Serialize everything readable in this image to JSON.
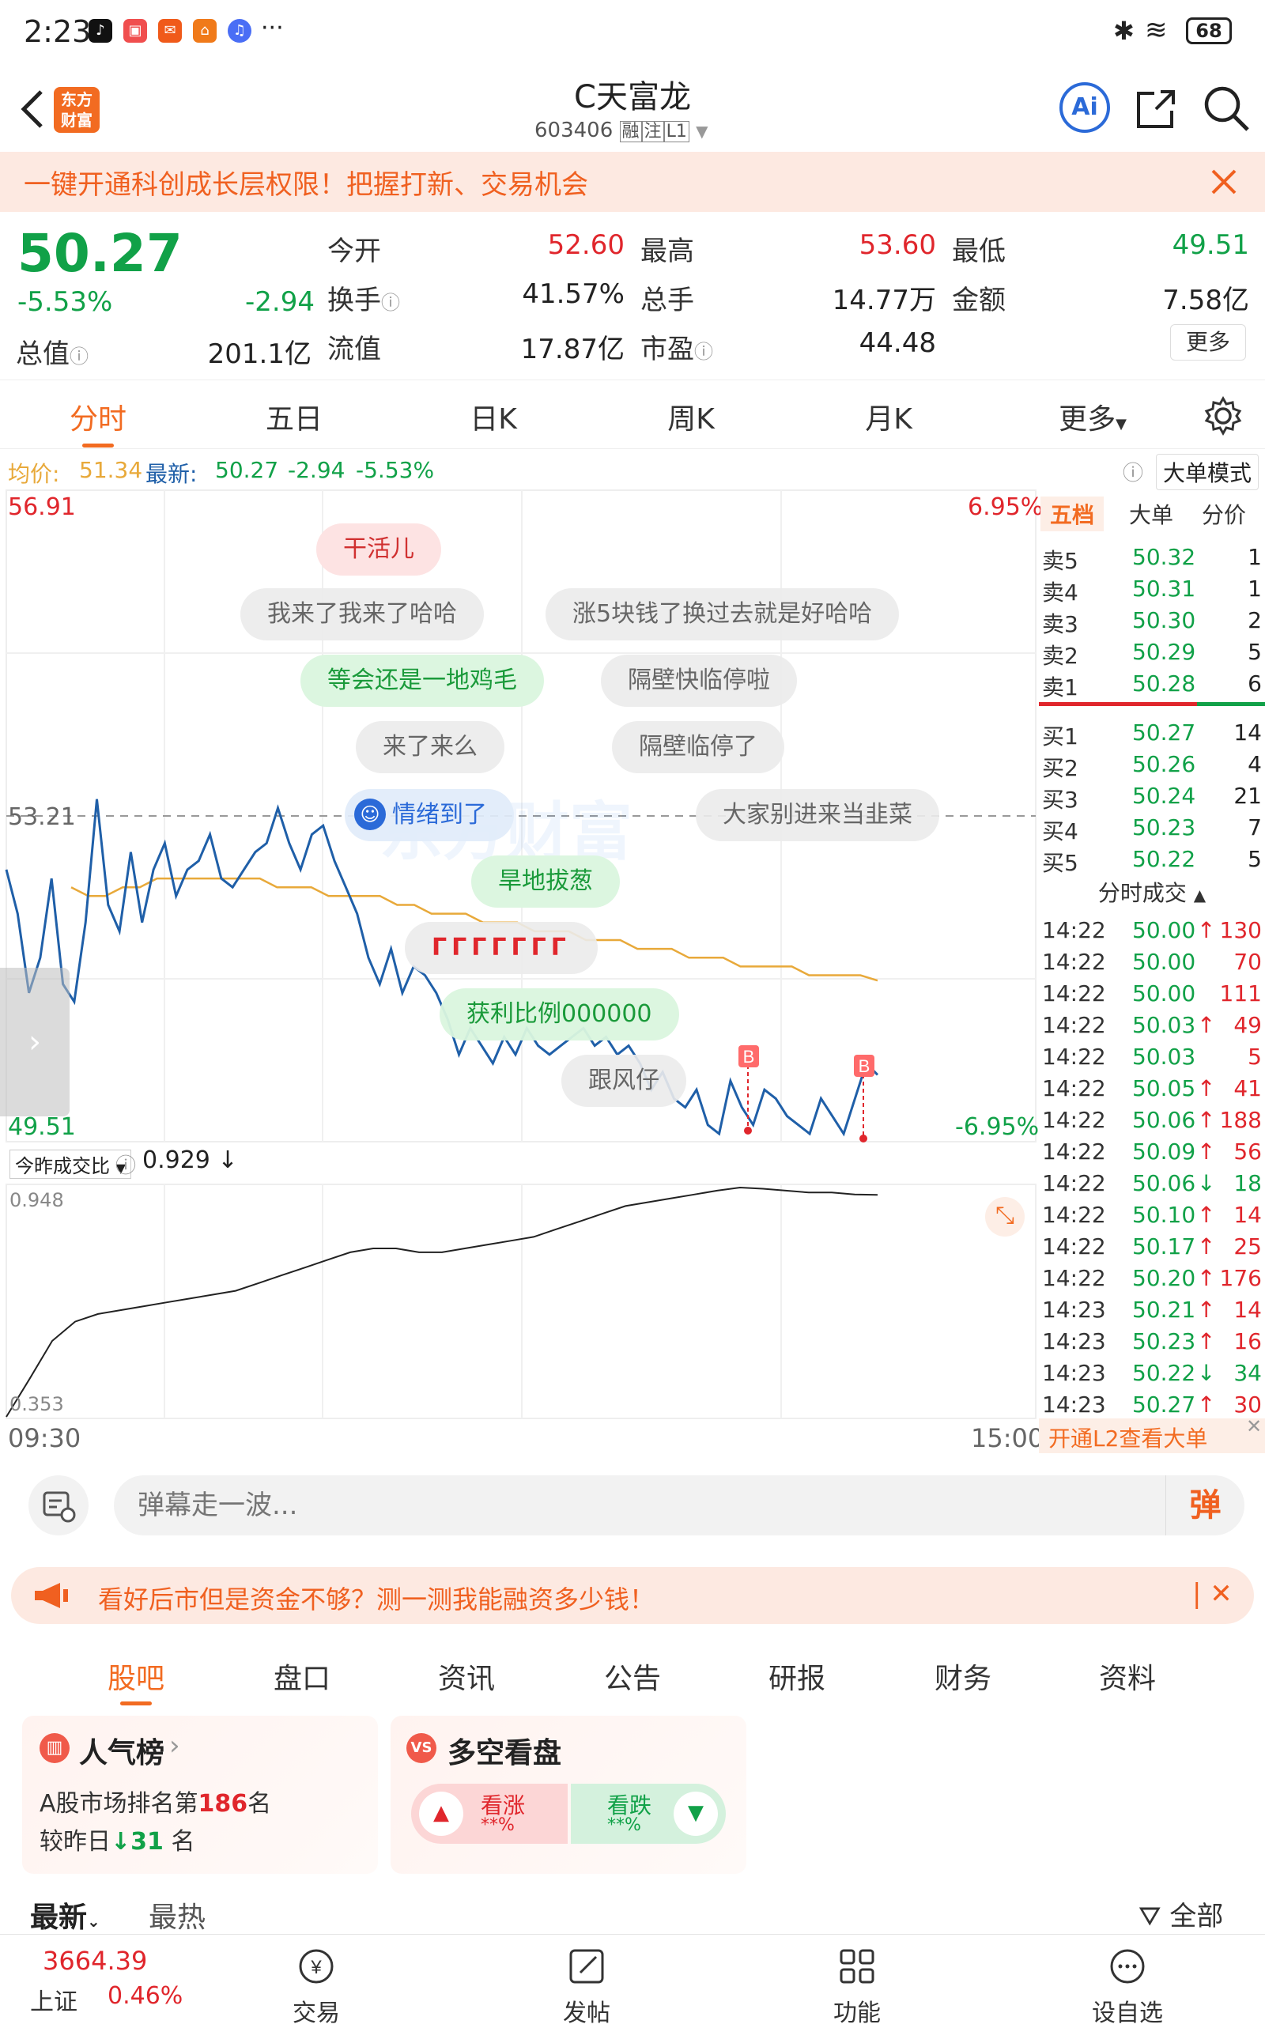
{
  "status_bar": {
    "time": "2:23",
    "more": "···",
    "battery": "68"
  },
  "header": {
    "back_icon": "chevron-left-icon",
    "logo_text": "东方\n财富",
    "title": "C天富龙",
    "code": "603406",
    "tags": [
      "融",
      "注",
      "L1"
    ],
    "ai_label": "Ai"
  },
  "banner": {
    "text": "一键开通科创成长层权限！把握打新、交易机会"
  },
  "quote": {
    "price": "50.27",
    "change_pct": "-5.53%",
    "change": "-2.94",
    "rows": [
      [
        {
          "label": "今开",
          "value": "52.60",
          "color": "red"
        },
        {
          "label": "最高",
          "value": "53.60",
          "color": "red"
        },
        {
          "label": "最低",
          "value": "49.51",
          "color": "green"
        }
      ],
      [
        {
          "label": "换手",
          "value": "41.57%",
          "color": "dark"
        },
        {
          "label": "总手",
          "value": "14.77万",
          "color": "dark"
        },
        {
          "label": "金额",
          "value": "7.58亿",
          "color": "dark"
        }
      ],
      [
        {
          "label": "流值",
          "value": "17.87亿",
          "color": "dark"
        },
        {
          "label": "市盈",
          "value": "44.48",
          "color": "dark"
        }
      ]
    ],
    "total_label": "总值",
    "total_value": "201.1亿",
    "more_button": "更多"
  },
  "tabs": [
    "分时",
    "五日",
    "日K",
    "周K",
    "月K",
    "更多"
  ],
  "chart_info": {
    "avg_label": "均价:",
    "avg_value": "51.34",
    "latest_label": "最新:",
    "latest_value": "50.27",
    "latest_change": "-2.94",
    "latest_pct": "-5.53%",
    "mode_button": "大单模式"
  },
  "chart_labels": {
    "y_high": "56.91",
    "y_low": "49.51",
    "y_mid": "53.21",
    "pct_high": "6.95%",
    "pct_low": "-6.95%",
    "indicator": "今昨成交比",
    "indicator_value": "0.929",
    "ind_high": "0.948",
    "ind_low": "0.353",
    "t_start": "09:30",
    "t_end": "15:00",
    "marker": "B"
  },
  "danmaku": [
    "干活儿",
    "我来了我来了哈哈",
    "涨5块钱了换过去就是好哈哈",
    "等会还是一地鸡毛",
    "隔壁快临停啦",
    "来了来么",
    "隔壁临停了",
    "情绪到了",
    "大家别进来当韭菜",
    "旱地拔葱",
    "ΓΓΓΓΓΓΓ",
    "获利比例000000",
    "跟风仔"
  ],
  "watermark": "东方财富",
  "chart_data": [
    {
      "type": "line",
      "title": "",
      "x_range": [
        "09:30",
        "15:00"
      ],
      "ylim": [
        49.51,
        56.91
      ],
      "reference": 53.21,
      "series": [
        {
          "name": "最新",
          "values": [
            52.6,
            52.1,
            51.2,
            51.6,
            52.5,
            51.3,
            51.1,
            52.0,
            53.4,
            52.2,
            51.9,
            52.8,
            52.0,
            52.6,
            52.9,
            52.3,
            52.6,
            52.7,
            53.0,
            52.5,
            52.4,
            52.6,
            52.8,
            52.9,
            53.3,
            52.9,
            52.6,
            53.0,
            53.1,
            52.7,
            52.4,
            52.1,
            51.6,
            51.3,
            51.7,
            51.2,
            51.5,
            51.4,
            51.2,
            50.9,
            50.5,
            50.8,
            50.6,
            50.4,
            50.7,
            50.5,
            50.8,
            50.6,
            50.5,
            50.6,
            50.7,
            50.8,
            50.6,
            50.7,
            50.5,
            50.6,
            50.4,
            50.1,
            50.3,
            50.0,
            49.9,
            50.1,
            49.7,
            49.6,
            50.2,
            49.9,
            49.7,
            50.1,
            50.0,
            49.8,
            49.7,
            49.6,
            50.0,
            49.8,
            49.6,
            50.0,
            50.4,
            50.27
          ]
        },
        {
          "name": "均价",
          "values": [
            52.4,
            52.3,
            52.3,
            52.4,
            52.4,
            52.5,
            52.5,
            52.5,
            52.5,
            52.5,
            52.5,
            52.5,
            52.4,
            52.4,
            52.4,
            52.3,
            52.3,
            52.3,
            52.3,
            52.2,
            52.2,
            52.1,
            52.1,
            52.1,
            52.0,
            52.0,
            52.0,
            51.9,
            51.9,
            51.9,
            51.8,
            51.8,
            51.8,
            51.7,
            51.7,
            51.7,
            51.6,
            51.6,
            51.6,
            51.5,
            51.5,
            51.5,
            51.5,
            51.4,
            51.4,
            51.4,
            51.4,
            51.34
          ]
        }
      ]
    },
    {
      "type": "line",
      "title": "",
      "ylim": [
        0.353,
        0.948
      ],
      "series": [
        {
          "name": "今昨成交比",
          "values": [
            0.353,
            0.45,
            0.55,
            0.6,
            0.62,
            0.63,
            0.64,
            0.65,
            0.66,
            0.67,
            0.68,
            0.7,
            0.72,
            0.74,
            0.76,
            0.78,
            0.79,
            0.79,
            0.78,
            0.78,
            0.79,
            0.8,
            0.81,
            0.82,
            0.84,
            0.86,
            0.88,
            0.9,
            0.91,
            0.92,
            0.93,
            0.94,
            0.948,
            0.945,
            0.94,
            0.935,
            0.935,
            0.93,
            0.929
          ]
        }
      ]
    }
  ],
  "order_book": {
    "tabs": [
      "五档",
      "大单",
      "分价"
    ],
    "asks": [
      {
        "label": "卖5",
        "price": "50.32",
        "vol": "1"
      },
      {
        "label": "卖4",
        "price": "50.31",
        "vol": "1"
      },
      {
        "label": "卖3",
        "price": "50.30",
        "vol": "2"
      },
      {
        "label": "卖2",
        "price": "50.29",
        "vol": "5"
      },
      {
        "label": "卖1",
        "price": "50.28",
        "vol": "6"
      }
    ],
    "bids": [
      {
        "label": "买1",
        "price": "50.27",
        "vol": "14"
      },
      {
        "label": "买2",
        "price": "50.26",
        "vol": "4"
      },
      {
        "label": "买3",
        "price": "50.24",
        "vol": "21"
      },
      {
        "label": "买4",
        "price": "50.23",
        "vol": "7"
      },
      {
        "label": "买5",
        "price": "50.22",
        "vol": "5"
      }
    ],
    "ticks_title": "分时成交",
    "ticks": [
      {
        "time": "14:22",
        "price": "50.00",
        "dir": "↑",
        "vol": "130",
        "vc": "red"
      },
      {
        "time": "14:22",
        "price": "50.00",
        "dir": "",
        "vol": "70",
        "vc": "red"
      },
      {
        "time": "14:22",
        "price": "50.00",
        "dir": "",
        "vol": "111",
        "vc": "red"
      },
      {
        "time": "14:22",
        "price": "50.03",
        "dir": "↑",
        "vol": "49",
        "vc": "red"
      },
      {
        "time": "14:22",
        "price": "50.03",
        "dir": "",
        "vol": "5",
        "vc": "red"
      },
      {
        "time": "14:22",
        "price": "50.05",
        "dir": "↑",
        "vol": "41",
        "vc": "red"
      },
      {
        "time": "14:22",
        "price": "50.06",
        "dir": "↑",
        "vol": "188",
        "vc": "red"
      },
      {
        "time": "14:22",
        "price": "50.09",
        "dir": "↑",
        "vol": "56",
        "vc": "red"
      },
      {
        "time": "14:22",
        "price": "50.06",
        "dir": "↓",
        "vol": "18",
        "vc": "green"
      },
      {
        "time": "14:22",
        "price": "50.10",
        "dir": "↑",
        "vol": "14",
        "vc": "red"
      },
      {
        "time": "14:22",
        "price": "50.17",
        "dir": "↑",
        "vol": "25",
        "vc": "red"
      },
      {
        "time": "14:22",
        "price": "50.20",
        "dir": "↑",
        "vol": "176",
        "vc": "red"
      },
      {
        "time": "14:23",
        "price": "50.21",
        "dir": "↑",
        "vol": "14",
        "vc": "red"
      },
      {
        "time": "14:23",
        "price": "50.23",
        "dir": "↑",
        "vol": "16",
        "vc": "red"
      },
      {
        "time": "14:23",
        "price": "50.22",
        "dir": "↓",
        "vol": "34",
        "vc": "green"
      },
      {
        "time": "14:23",
        "price": "50.27",
        "dir": "↑",
        "vol": "30",
        "vc": "red"
      }
    ],
    "l2_link": "开通L2查看大单"
  },
  "input": {
    "placeholder": "弹幕走一波...",
    "send_label": "弹"
  },
  "ad": {
    "text": "看好后市但是资金不够？测一测我能融资多少钱！"
  },
  "bottom_tabs": [
    "股吧",
    "盘口",
    "资讯",
    "公告",
    "研报",
    "财务",
    "资料"
  ],
  "cards": {
    "popularity_title": "人气榜",
    "rank_prefix": "A股市场排名第",
    "rank": "186",
    "rank_suffix": "名",
    "compare_prefix": "较昨日",
    "compare_value": "31",
    "compare_suffix": "名",
    "vs_title": "多空看盘",
    "bull_label": "看涨",
    "bull_value": "**%",
    "bear_label": "看跌",
    "bear_value": "**%"
  },
  "sort": {
    "latest": "最新",
    "hottest": "最热",
    "filter": "全部"
  },
  "navbar": {
    "index_value": "3664.39",
    "index_name": "上证",
    "index_pct": "0.46%",
    "items": [
      "交易",
      "发帖",
      "功能",
      "设自选"
    ]
  },
  "colors": {
    "red": "#e0262c",
    "green": "#11a148",
    "accent": "#f26b21",
    "avg_line": "#e8a93a",
    "price_line": "#1f5fa8"
  }
}
